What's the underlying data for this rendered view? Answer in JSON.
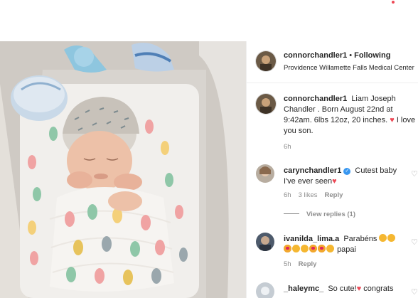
{
  "colors": {
    "accent": "#3897f0",
    "heart": "#ed4956",
    "meta": "#8e8e8e",
    "text": "#262626"
  },
  "post": {
    "username": "connorchandler1",
    "separator": "•",
    "follow_status": "Following",
    "location": "Providence Willamette Falls Medical Center"
  },
  "caption": {
    "username": "connorchandler1",
    "text": "Liam Joseph Chandler . Born August 22nd at 9:42am. 6lbs 12oz, 20 inches.",
    "heart": "♥",
    "text_end": "I love you son.",
    "time": "6h"
  },
  "comments": [
    {
      "username": "carynchandler1",
      "verified_icon": "✓",
      "text": "Cutest baby I've ever seen",
      "heart": "♥",
      "time": "6h",
      "likes": "3 likes",
      "reply_label": "Reply",
      "view_replies": "View replies (1)",
      "like_icon": "♡"
    },
    {
      "username": "ivanilda_lima.a",
      "text": "Parabéns",
      "text2": "papai",
      "time": "5h",
      "reply_label": "Reply",
      "like_icon": "♡"
    },
    {
      "username": "_haleymc_",
      "text": "So cute!",
      "heart": "♥",
      "text_end": "congrats",
      "like_icon": "♡"
    }
  ]
}
